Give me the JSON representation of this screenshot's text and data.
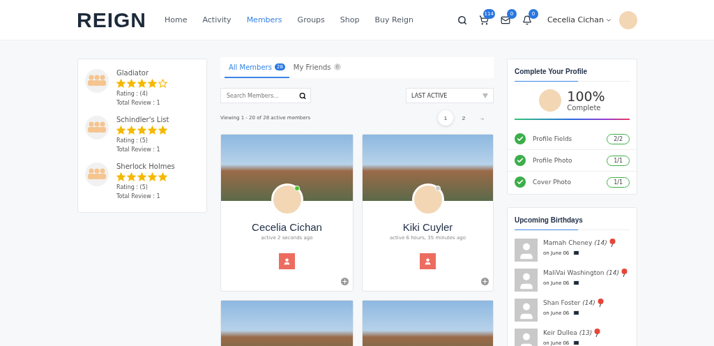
{
  "header": {
    "logo": "REIGN",
    "nav": [
      {
        "label": "Home",
        "selected": false
      },
      {
        "label": "Activity",
        "selected": false
      },
      {
        "label": "Members",
        "selected": true
      },
      {
        "label": "Groups",
        "selected": false
      },
      {
        "label": "Shop",
        "selected": false
      },
      {
        "label": "Buy Reign",
        "selected": false
      }
    ],
    "cart_count": "114",
    "messages_count": "0",
    "notifications_count": "0",
    "user_name": "Cecelia Cichan"
  },
  "ratings": [
    {
      "title": "Gladiator",
      "stars": 4,
      "rating": "Rating : (4)",
      "reviews": "Total Review : 1"
    },
    {
      "title": "Schindler's List",
      "stars": 5,
      "rating": "Rating : (5)",
      "reviews": "Total Review : 1"
    },
    {
      "title": "Sherlock Holmes",
      "stars": 5,
      "rating": "Rating : (5)",
      "reviews": "Total Review : 1"
    }
  ],
  "tabs": [
    {
      "label": "All Members",
      "count": "28",
      "selected": true
    },
    {
      "label": "My Friends",
      "count": "0",
      "selected": false
    }
  ],
  "search": {
    "placeholder": "Search Members..."
  },
  "sort": "LAST ACTIVE",
  "viewing": "Viewing 1 - 20 of 28 active members",
  "pagination": [
    {
      "label": "1",
      "selected": true
    },
    {
      "label": "2",
      "selected": false
    },
    {
      "label": "→",
      "selected": false
    }
  ],
  "members": [
    {
      "kind": "profile",
      "name": "Cecelia Cichan",
      "active": "active 2 seconds ago",
      "online": true
    },
    {
      "kind": "profile",
      "name": "Kiki Cuyler",
      "active": "active 6 hours, 35 minutes ago",
      "online": false
    },
    {
      "kind": "cover"
    },
    {
      "kind": "cover"
    }
  ],
  "profile": {
    "title": "Complete Your Profile",
    "percent": "100%",
    "caption": "Complete",
    "level": 1,
    "items": [
      {
        "label": "Profile Fields",
        "count": "2/2",
        "checked": true
      },
      {
        "label": "Profile Photo",
        "count": "1/1",
        "checked": true
      },
      {
        "label": "Cover Photo",
        "count": "1/1",
        "checked": true
      }
    ]
  },
  "birthdays": {
    "title": "Upcoming Birthdays",
    "items": [
      {
        "name": "Mamah Cheney",
        "age": "(14)",
        "date": "on June 06"
      },
      {
        "name": "MaliVai Washington",
        "age": "(14)",
        "date": "on June 06"
      },
      {
        "name": "Shan Foster",
        "age": "(14)",
        "date": "on June 06"
      },
      {
        "name": "Keir Dullea",
        "age": "(13)",
        "date": "on June 06"
      }
    ]
  }
}
